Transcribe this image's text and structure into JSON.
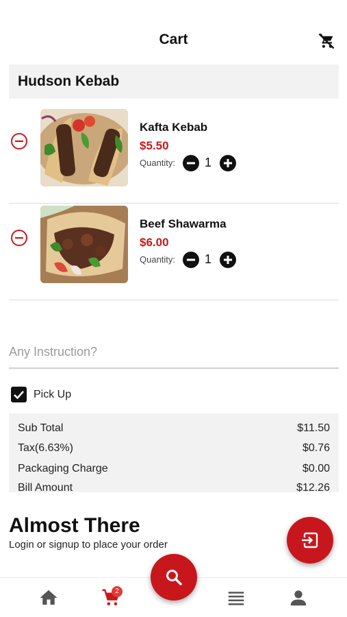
{
  "header": {
    "title": "Cart",
    "clear_icon": "remove-shopping-cart-icon"
  },
  "restaurant": {
    "name": "Hudson Kebab"
  },
  "items": [
    {
      "name": "Kafta Kebab",
      "price": "$5.50",
      "quantity_label": "Quantity:",
      "quantity": "1"
    },
    {
      "name": "Beef Shawarma",
      "price": "$6.00",
      "quantity_label": "Quantity:",
      "quantity": "1"
    }
  ],
  "instruction": {
    "placeholder": "Any Instruction?",
    "value": ""
  },
  "pickup": {
    "label": "Pick Up",
    "checked": true
  },
  "summary": [
    {
      "label": "Sub Total",
      "value": "$11.50"
    },
    {
      "label": "Tax(6.63%)",
      "value": "$0.76"
    },
    {
      "label": "Packaging Charge",
      "value": "$0.00"
    },
    {
      "label": "Bill Amount",
      "value": "$12.26"
    }
  ],
  "login_panel": {
    "heading": "Almost There",
    "subtext": "Login or signup to place your order",
    "button_icon": "login-icon"
  },
  "nav": {
    "cart_badge": "2",
    "items": [
      "home-icon",
      "cart-icon",
      "search-icon",
      "menu-list-icon",
      "profile-icon"
    ]
  },
  "colors": {
    "accent": "#c8171c",
    "price": "#c8171c",
    "panel": "#f2f2f2"
  }
}
